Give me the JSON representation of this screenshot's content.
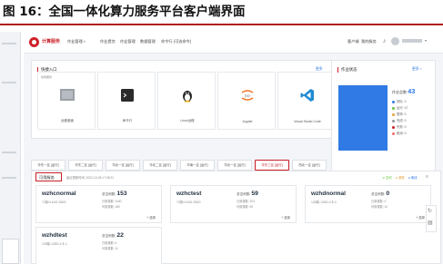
{
  "caption": "图 16：全国一体化算力服务平台客户端界面",
  "brand": {
    "name": "计算服务",
    "accent": "#c81f26",
    "blue": "#2f7ae5"
  },
  "nav": [
    {
      "label": "作业管理",
      "caret": "▾"
    },
    {
      "label": "作业提交"
    },
    {
      "label": "作业管理"
    },
    {
      "label": "数据管理"
    },
    {
      "label": "命令行 (可选命令)"
    }
  ],
  "right_nav": {
    "item1": "客户端",
    "item2": "我的服务"
  },
  "quick": {
    "title": "快捷入口",
    "tag": "常用服务",
    "link": "更多",
    "tools": [
      {
        "label": "远程桌面",
        "icon": "bash-icon"
      },
      {
        "label": "命令行",
        "icon": "terminal-icon"
      },
      {
        "label": "Linux远程",
        "icon": "linux-icon"
      },
      {
        "label": "Jupyter",
        "icon": "jupyter-icon"
      },
      {
        "label": "Visual Studio Code",
        "icon": "vscode-icon"
      }
    ]
  },
  "stats": {
    "title": "作业状态",
    "link": "更多 >",
    "total_label": "作业总数",
    "total": "43",
    "legend": [
      {
        "label": "排队: 0",
        "color": "#2f7ae5"
      },
      {
        "label": "运行: 47",
        "color": "#67c23a"
      },
      {
        "label": "暂停: 0",
        "color": "#e6a23c"
      },
      {
        "label": "完成: 0",
        "color": "#909399"
      },
      {
        "label": "失败: 0",
        "color": "#c81f26"
      },
      {
        "label": "取消: 0",
        "color": "#f56c6c"
      }
    ]
  },
  "filters": [
    {
      "label": "华东一区 [运行]",
      "active": false
    },
    {
      "label": "华东二区 [运行]",
      "active": false
    },
    {
      "label": "华北一区 [运行]",
      "active": false
    },
    {
      "label": "华北二区 [运行]",
      "active": false
    },
    {
      "label": "华南一区 [运行]",
      "active": false
    },
    {
      "label": "华北一区 [运行]",
      "active": false
    },
    {
      "label": "华东三区 [运行]",
      "active": true
    },
    {
      "label": "西北一区 [运行]",
      "active": false
    }
  ],
  "servers_section": {
    "title": "可用服务",
    "meta": "最近更新时间: 2022-10-08 17:08:21",
    "legend": [
      "● 空闲",
      "● 满载",
      "● 离线"
    ],
    "toggle": "≡"
  },
  "servers": [
    {
      "name": "wzhcnormal",
      "spec": "72核/4 64G 256G",
      "count_label": "总空闲数:",
      "count": "153",
      "line1": "已用核数: 1160",
      "line2": "可用核数: 180",
      "more": "+ 选择"
    },
    {
      "name": "wzhctest",
      "spec": "72核/4 64G 256G",
      "count_label": "总空闲数:",
      "count": "59",
      "line1": "已用核数: 203",
      "line2": "可用核数: 90",
      "more": "+ 选择"
    },
    {
      "name": "wzhdnormal",
      "spec": "128核-128G-4卡-1",
      "count_label": "总空闲数:",
      "count": "0",
      "line1": "已用核数: 0",
      "line2": "可用核数: 10",
      "more": "+ 选择"
    },
    {
      "name": "wzhdtest",
      "spec": "128核-128G-4卡-1",
      "count_label": "总空闲数:",
      "count": "22",
      "line1": "已用核数: 6",
      "line2": "可用核数: 11",
      "more": "+ 选择"
    }
  ]
}
